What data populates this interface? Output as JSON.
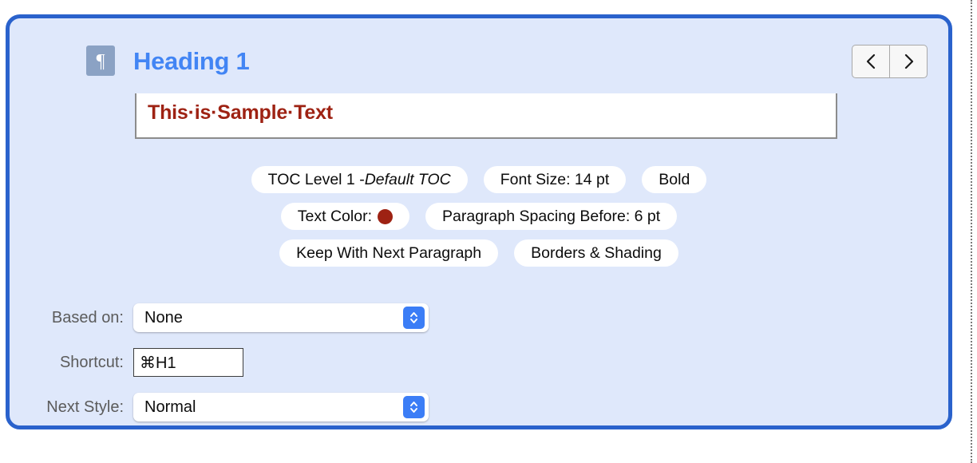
{
  "panel": {
    "icon_name": "paragraph-pilcrow-icon",
    "title": "Heading 1",
    "nav": {
      "previous_label": "‹",
      "next_label": "›"
    },
    "colors": {
      "panel_border": "#2a62cc",
      "panel_background": "#dfe8fb",
      "title": "#4285f4",
      "sample_text": "#9e2213",
      "sample_rule": "#13189c",
      "accent_stepper": "#3b7df6"
    }
  },
  "preview": {
    "sample_text": "This·is·Sample·Text"
  },
  "attributes": {
    "rows": [
      [
        {
          "prefix": "TOC Level 1 - ",
          "emphasis": "Default TOC"
        },
        {
          "text": "Font Size: 14 pt"
        },
        {
          "text": "Bold"
        }
      ],
      [
        {
          "text": "Text Color:",
          "swatch": "#9e2213"
        },
        {
          "text": "Paragraph Spacing Before: 6 pt"
        }
      ],
      [
        {
          "text": "Keep With Next Paragraph"
        },
        {
          "text": "Borders & Shading"
        }
      ]
    ]
  },
  "form": {
    "based_on": {
      "label": "Based on:",
      "value": "None"
    },
    "shortcut": {
      "label": "Shortcut:",
      "value": "⌘H1"
    },
    "next_style": {
      "label": "Next Style:",
      "value": "Normal"
    }
  }
}
